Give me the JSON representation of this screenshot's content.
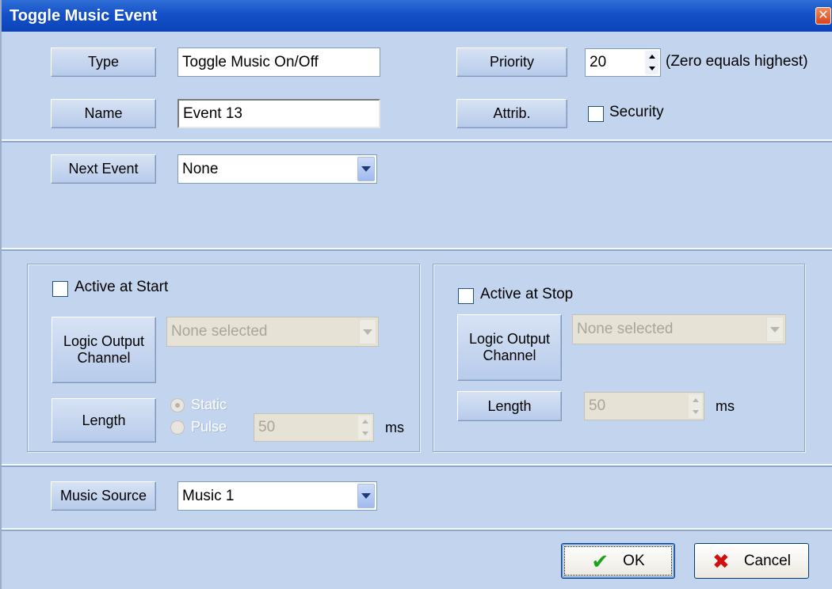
{
  "window": {
    "title": "Toggle Music Event",
    "close_glyph": "✕"
  },
  "general": {
    "type_label": "Type",
    "type_value": "Toggle Music On/Off",
    "name_label": "Name",
    "name_value": "Event 13",
    "priority_label": "Priority",
    "priority_value": "20",
    "priority_hint": "(Zero equals highest)",
    "attrib_label": "Attrib.",
    "security_label": "Security",
    "security_checked": false
  },
  "next_event": {
    "label": "Next Event",
    "value": "None"
  },
  "start": {
    "active_label": "Active at Start",
    "active_checked": false,
    "channel_label_line1": "Logic Output",
    "channel_label_line2": "Channel",
    "channel_value": "None selected",
    "length_label": "Length",
    "static_label": "Static",
    "pulse_label": "Pulse",
    "length_value": "50",
    "unit": "ms"
  },
  "stop": {
    "active_label": "Active at Stop",
    "active_checked": false,
    "channel_label_line1": "Logic Output",
    "channel_label_line2": "Channel",
    "channel_value": "None selected",
    "length_label": "Length",
    "length_value": "50",
    "unit": "ms"
  },
  "music": {
    "label": "Music Source",
    "value": "Music 1"
  },
  "buttons": {
    "ok_label": "OK",
    "cancel_label": "Cancel",
    "ok_icon": "check-icon",
    "cancel_icon": "x-icon"
  },
  "colors": {
    "titlebar": "#1550c8",
    "dialog_bg": "#c3d4ee",
    "ok_icon": "#1ca21c",
    "cancel_icon": "#d01010"
  }
}
